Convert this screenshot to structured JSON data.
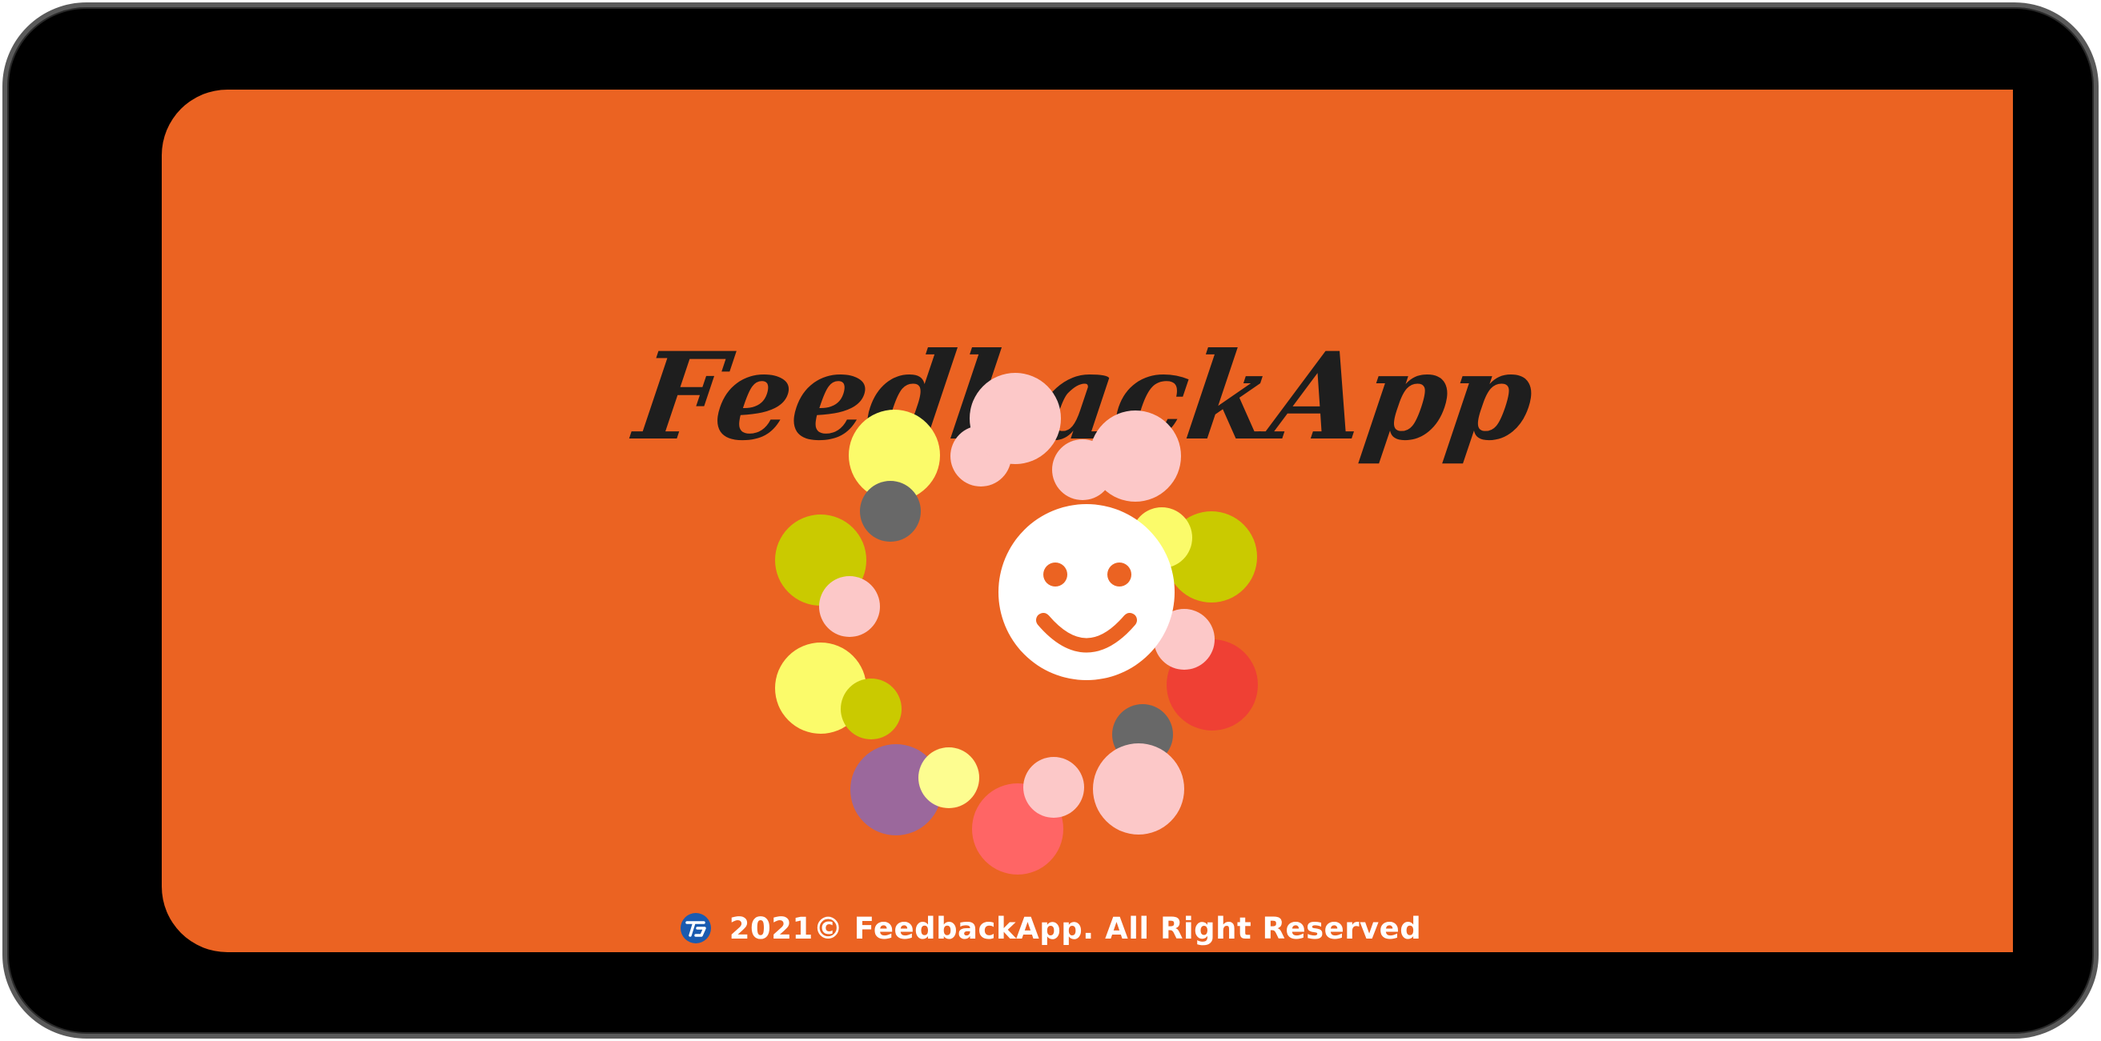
{
  "app": {
    "title": "FeedbackApp",
    "copyright": "2021© FeedbackApp. All Right Reserved"
  },
  "colors": {
    "background": "#EB6322",
    "device_frame": "#000000",
    "smiley": "#FFFFFF",
    "title": "#1E1E1E",
    "bubble_yellow": "#FBFB6A",
    "bubble_olive": "#CACA00",
    "bubble_pink": "#FCC8C8",
    "bubble_gray": "#686868",
    "bubble_red": "#EF4034",
    "bubble_purple": "#9B689C",
    "bubble_coral": "#FF6565",
    "logo_blue": "#1A5BB0"
  },
  "icons": {
    "smiley": "smiley-face-icon",
    "footer_logo": "company-logo-icon"
  }
}
